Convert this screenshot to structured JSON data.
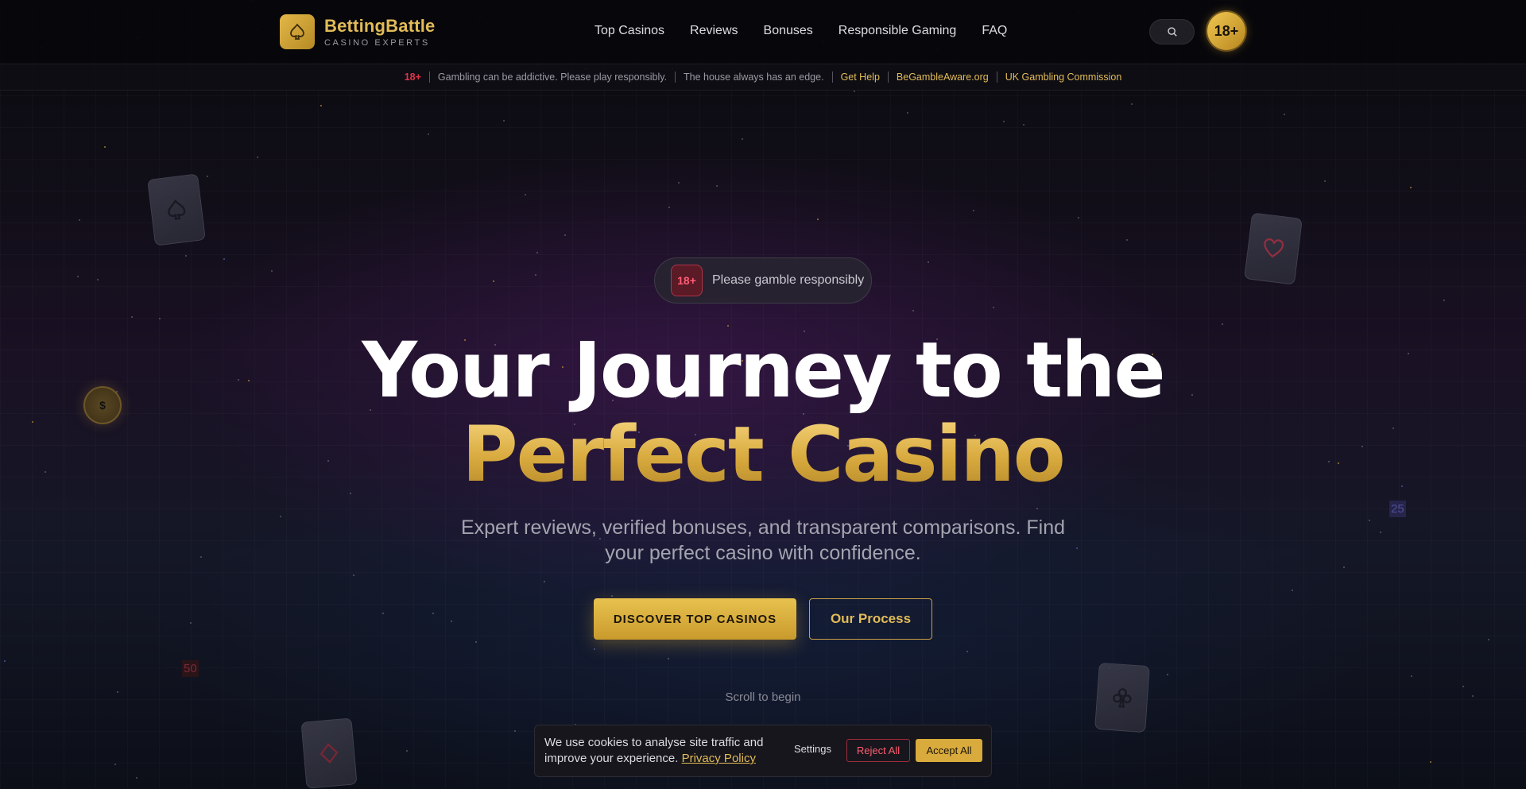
{
  "brand": {
    "name": "BettingBattle",
    "tagline": "CASINO EXPERTS",
    "icon": "spade-icon"
  },
  "nav": {
    "items": [
      {
        "label": "Top Casinos"
      },
      {
        "label": "Reviews"
      },
      {
        "label": "Bonuses"
      },
      {
        "label": "Responsible Gaming"
      },
      {
        "label": "FAQ"
      }
    ],
    "search_icon": "search-icon",
    "age_badge": "18+"
  },
  "notice_bar": {
    "age": "18+",
    "message": "Gambling can be addictive. Please play responsibly.",
    "edge": "The house always has an edge.",
    "links": [
      "Get Help",
      "BeGambleAware.org",
      "UK Gambling Commission"
    ]
  },
  "decor": {
    "coin_symbol": "$",
    "chip_25": "25",
    "chip_50": "50"
  },
  "hero": {
    "pill_age": "18+",
    "pill_text": "Please gamble responsibly",
    "title_line1": "Your Journey to the",
    "title_line2": "Perfect Casino",
    "subtitle": "Expert reviews, verified bonuses, and transparent comparisons. Find your perfect casino with confidence.",
    "primary_cta": "DISCOVER TOP CASINOS",
    "secondary_cta": "Our Process",
    "scroll_hint": "Scroll to begin"
  },
  "cookie_banner": {
    "text": "We use cookies to analyse site traffic and improve your experience.",
    "policy_link": "Privacy Policy",
    "settings": "Settings",
    "reject": "Reject All",
    "accept": "Accept All"
  },
  "colors": {
    "accent_gold": "#e2bb58",
    "danger_red": "#e0344a",
    "background": "#0a0a0e"
  }
}
